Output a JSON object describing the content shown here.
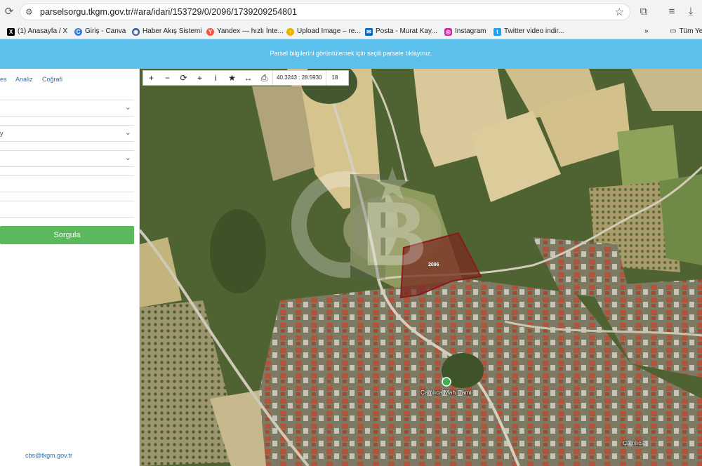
{
  "browser": {
    "url": "parselsorgu.tkgm.gov.tr/#ara/idari/153729/0/2096/1739209254801",
    "bookmarks": [
      {
        "label": "(1) Anasayfa / X",
        "icon": "x-logo-icon",
        "color": "#000000"
      },
      {
        "label": "Giriş - Canva",
        "icon": "canva-icon",
        "color": "#3a7bd5"
      },
      {
        "label": "Haber Akış Sistemi",
        "icon": "rss-icon",
        "color": "#3b5998"
      },
      {
        "label": "Yandex — hızlı İnte...",
        "icon": "yandex-icon",
        "color": "#f2543d"
      },
      {
        "label": "Upload Image – re...",
        "icon": "upload-icon",
        "color": "#e8b400"
      },
      {
        "label": "Posta - Murat Kay...",
        "icon": "mail-icon",
        "color": "#0a66c2"
      },
      {
        "label": "Instagram",
        "icon": "instagram-icon",
        "color": "#d6249f"
      },
      {
        "label": "Twitter video indir...",
        "icon": "twitter-icon",
        "color": "#1da1f2"
      }
    ],
    "bookmark_more": "»",
    "bookmark_folder": "Tüm Ye"
  },
  "banner": {
    "text": "Parsel bilgilerini görüntülemek için seçili parsele tıklayınız.",
    "color": "#5bc0eb"
  },
  "panel": {
    "tabs": [
      "es",
      "Analiz",
      "Coğrafi"
    ],
    "fields": [
      {
        "value": "",
        "dropdown": true
      },
      {
        "value": "y",
        "dropdown": true
      },
      {
        "value": "",
        "dropdown": true
      },
      {
        "value": "",
        "dropdown": false
      },
      {
        "value": "",
        "dropdown": false
      }
    ],
    "search_button": "Sorgula",
    "search_color": "#5cb85c",
    "email": "cbs@tkgm.gov.tr"
  },
  "map": {
    "toolbar": {
      "coordinates": "40.3243 : 28.5930",
      "zoom": "18"
    },
    "parcel": {
      "label": "2096",
      "outline_color": "#8b1a1a"
    },
    "place": "Çamlıca Mah Camii",
    "place_small": "Çamlıca"
  }
}
